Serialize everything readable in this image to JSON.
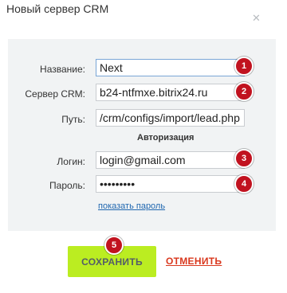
{
  "dialog": {
    "title": "Новый сервер CRM",
    "close_icon": "close-icon"
  },
  "form": {
    "name": {
      "label": "Название:",
      "value": "Next",
      "badge": "1"
    },
    "server": {
      "label": "Сервер CRM:",
      "value": "b24-ntfmxe.bitrix24.ru",
      "badge": "2"
    },
    "path": {
      "label": "Путь:",
      "value": "/crm/configs/import/lead.php"
    },
    "auth_section": "Авторизация",
    "login": {
      "label": "Логин:",
      "value": "login@gmail.com",
      "badge": "3"
    },
    "password": {
      "label": "Пароль:",
      "value": "123456789",
      "badge": "4"
    },
    "show_password": "показать пароль"
  },
  "actions": {
    "save_label": "СОХРАНИТЬ",
    "save_badge": "5",
    "cancel_label": "ОТМЕНИТЬ"
  },
  "colors": {
    "badge": "#c1121f",
    "save_button": "#bbed21",
    "cancel": "#d9381e",
    "link": "#2067b0",
    "panel": "#f1f3f4"
  }
}
